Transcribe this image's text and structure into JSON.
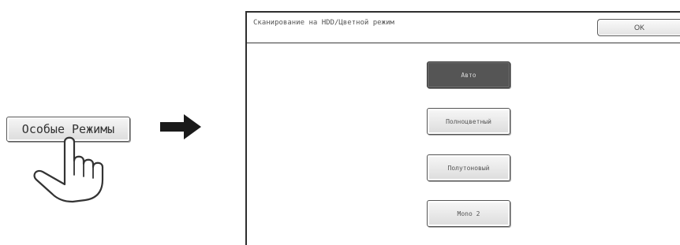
{
  "special_modes_key": {
    "label": "Особые Режимы"
  },
  "icons": {
    "pointer": "hand-pointer-icon",
    "next": "arrow-right-icon"
  },
  "screen": {
    "title": "Сканирование на HDD/Цветной режим",
    "ok_label": "OK",
    "options": [
      {
        "label": "Авто",
        "selected": true
      },
      {
        "label": "Полноцветный",
        "selected": false
      },
      {
        "label": "Полутоновый",
        "selected": false
      },
      {
        "label": "Mono 2",
        "selected": false
      }
    ]
  },
  "colors": {
    "selected_button": "#555555",
    "button_face": "#e8e8e8",
    "border": "#2e2e2e"
  }
}
